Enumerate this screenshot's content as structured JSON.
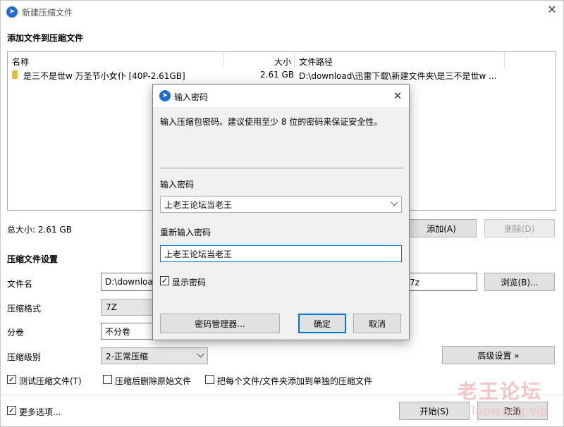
{
  "window": {
    "title": "新建压缩文件",
    "section_add": "添加文件到压缩文件",
    "columns": {
      "name": "名称",
      "size": "大小",
      "path": "文件路径"
    },
    "files": [
      {
        "name": "是三不是世w 万圣节小女仆 [40P-2.61GB]",
        "size": "2.61 GB",
        "path": "D:\\download\\迅雷下载\\新建文件夹\\是三不是世w ..."
      }
    ],
    "total_size": "总大小: 2.61 GB",
    "add_button": "添加(A)",
    "delete_button": "删除(D)",
    "settings_title": "压缩文件设置",
    "filename_label": "文件名",
    "filename_value": "D:\\downloa",
    "filename_ext": "7z",
    "browse_button": "浏览(B)...",
    "format_label": "压缩格式",
    "format_value": "7Z",
    "volume_label": "分卷",
    "volume_value": "不分卷",
    "level_label": "压缩级别",
    "level_value": "2-正常压缩",
    "advanced_button": "高级设置 »",
    "test_option": "测试压缩文件(T)",
    "delete_after_option": "压缩后删除原始文件",
    "separate_option": "把每个文件/文件夹添加到单独的压缩文件",
    "more_options": "更多选项...",
    "start_button": "开始(S)",
    "cancel_button": "取消",
    "check_mark": "✓",
    "watermark": "老王论坛",
    "watermark_url": "laowang.vip"
  },
  "dialog": {
    "title": "输入密码",
    "hint": "输入压缩包密码。建议使用至少 8 位的密码来保证安全性。",
    "password_label": "输入密码",
    "password_value": "上老王论坛当老王",
    "repeat_label": "重新输入密码",
    "repeat_value": "上老王论坛当老王",
    "show_password": "显示密码",
    "manager_button": "密码管理器...",
    "ok_button": "确定",
    "cancel_button": "取消"
  },
  "colors": {
    "accent": "#0078d7",
    "watermark": "#f2c6c6"
  }
}
